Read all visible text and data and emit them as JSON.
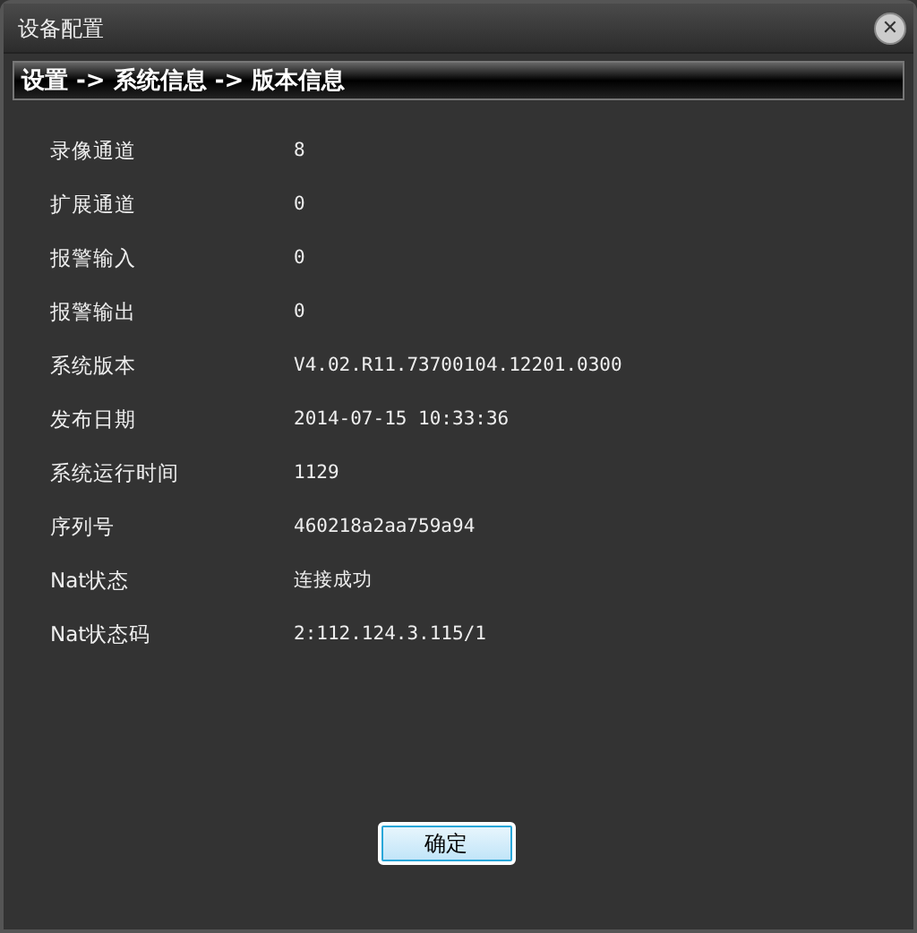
{
  "window": {
    "title": "设备配置",
    "close": "✕"
  },
  "breadcrumb": "设置 -> 系统信息 -> 版本信息",
  "rows": [
    {
      "label": "录像通道",
      "value": "8"
    },
    {
      "label": "扩展通道",
      "value": "0"
    },
    {
      "label": "报警输入",
      "value": "0"
    },
    {
      "label": "报警输出",
      "value": "0"
    },
    {
      "label": "系统版本",
      "value": "V4.02.R11.73700104.12201.0300"
    },
    {
      "label": "发布日期",
      "value": "2014-07-15 10:33:36"
    },
    {
      "label": "系统运行时间",
      "value": "1129"
    },
    {
      "label": "序列号",
      "value": "460218a2aa759a94"
    },
    {
      "label": "Nat状态",
      "value": "连接成功"
    },
    {
      "label": "Nat状态码",
      "value": "2:112.124.3.115/1"
    }
  ],
  "buttons": [
    "确定"
  ]
}
